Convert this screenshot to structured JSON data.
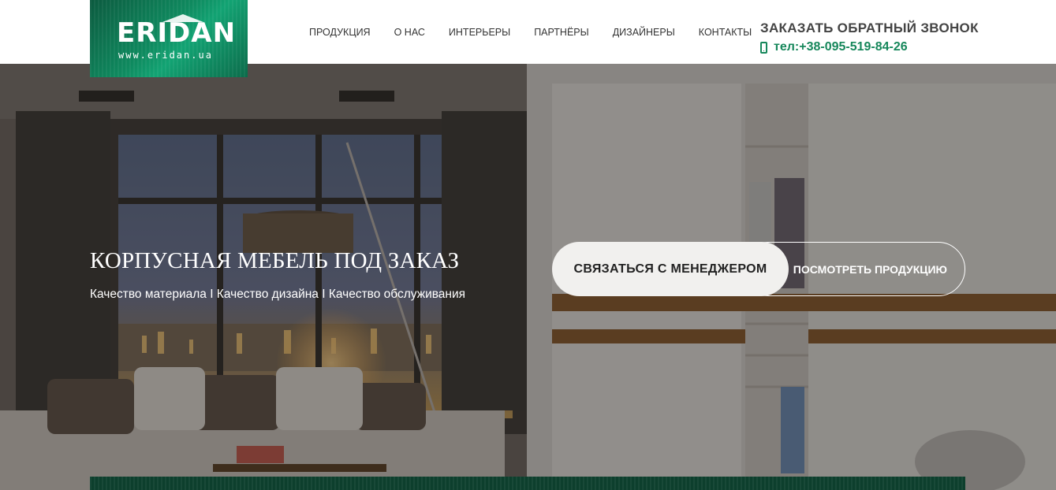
{
  "brand": {
    "logo_text": "ERIDAN",
    "logo_url": "www.eridan.ua",
    "colors": {
      "accent": "#16875b",
      "logo_bg": "#0f8a5f",
      "bar": "#0d3f2d"
    }
  },
  "nav": {
    "items": [
      {
        "label": "ПРОДУКЦИЯ"
      },
      {
        "label": "О НАС"
      },
      {
        "label": "ИНТЕРЬЕРЫ"
      },
      {
        "label": "ПАРТНЁРЫ"
      },
      {
        "label": "ДИЗАЙНЕРЫ"
      },
      {
        "label": "КОНТАКТЫ"
      }
    ]
  },
  "header": {
    "callback_label": "ЗАКАЗАТЬ ОБРАТНЫЙ ЗВОНОК",
    "phone_label": "тел:+38-095-519-84-26",
    "phone_icon": "mobile-phone-icon"
  },
  "hero": {
    "title": "КОРПУСНАЯ МЕБЕЛЬ ПОД ЗАКАЗ",
    "subtitle": "Качество материала I Качество дизайна I Качество обслуживания",
    "primary_button": "Связаться с менеджером",
    "secondary_button": "посмотреть продукцию"
  }
}
